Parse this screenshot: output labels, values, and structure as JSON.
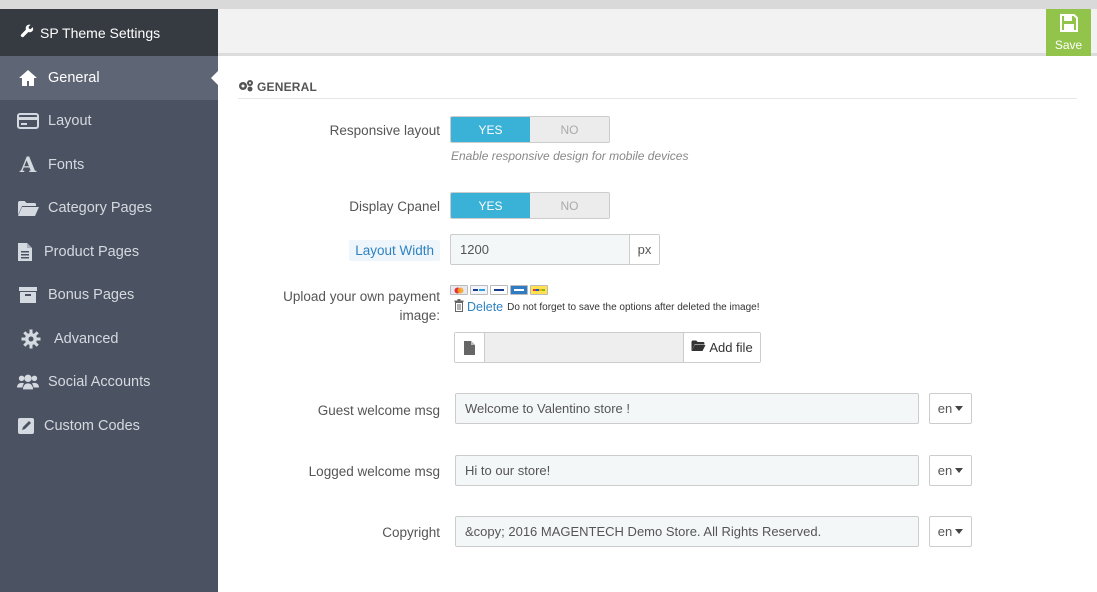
{
  "sidebar": {
    "title": "SP Theme Settings",
    "items": [
      {
        "label": "General",
        "icon": "home-icon"
      },
      {
        "label": "Layout",
        "icon": "credit-card-icon"
      },
      {
        "label": "Fonts",
        "icon": "font-icon"
      },
      {
        "label": "Category Pages",
        "icon": "folder-open-icon"
      },
      {
        "label": "Product Pages",
        "icon": "file-icon"
      },
      {
        "label": "Bonus Pages",
        "icon": "archive-icon"
      },
      {
        "label": "Advanced",
        "icon": "gear-icon"
      },
      {
        "label": "Social Accounts",
        "icon": "users-icon"
      },
      {
        "label": "Custom Codes",
        "icon": "edit-icon"
      }
    ]
  },
  "toolbar": {
    "save_label": "Save"
  },
  "section": {
    "title": "GENERAL"
  },
  "form": {
    "responsive": {
      "label": "Responsive layout",
      "yes": "YES",
      "no": "NO",
      "help": "Enable responsive design for mobile devices"
    },
    "cpanel": {
      "label": "Display Cpanel",
      "yes": "YES",
      "no": "NO"
    },
    "layout_width": {
      "label": "Layout Width",
      "value": "1200",
      "unit": "px"
    },
    "payment": {
      "label": "Upload your own payment image:",
      "cards": [
        "mastercard",
        "paypal",
        "visa",
        "amex",
        "ebay"
      ],
      "delete_label": "Delete",
      "delete_note": "Do not forget to save the options after deleted the image!",
      "add_file_label": "Add file"
    },
    "guest_msg": {
      "label": "Guest welcome msg",
      "value": "Welcome to Valentino store !",
      "lang": "en"
    },
    "logged_msg": {
      "label": "Logged welcome msg",
      "value": "Hi to our store!",
      "lang": "en"
    },
    "copyright": {
      "label": "Copyright",
      "value": "&copy; 2016 MAGENTECH Demo Store. All Rights Reserved.",
      "lang": "en"
    }
  },
  "colors": {
    "sidebar_bg": "#4b5261",
    "active_item": "#5e6574",
    "accent_blue": "#3ab1d6",
    "save_green": "#92c34a"
  }
}
